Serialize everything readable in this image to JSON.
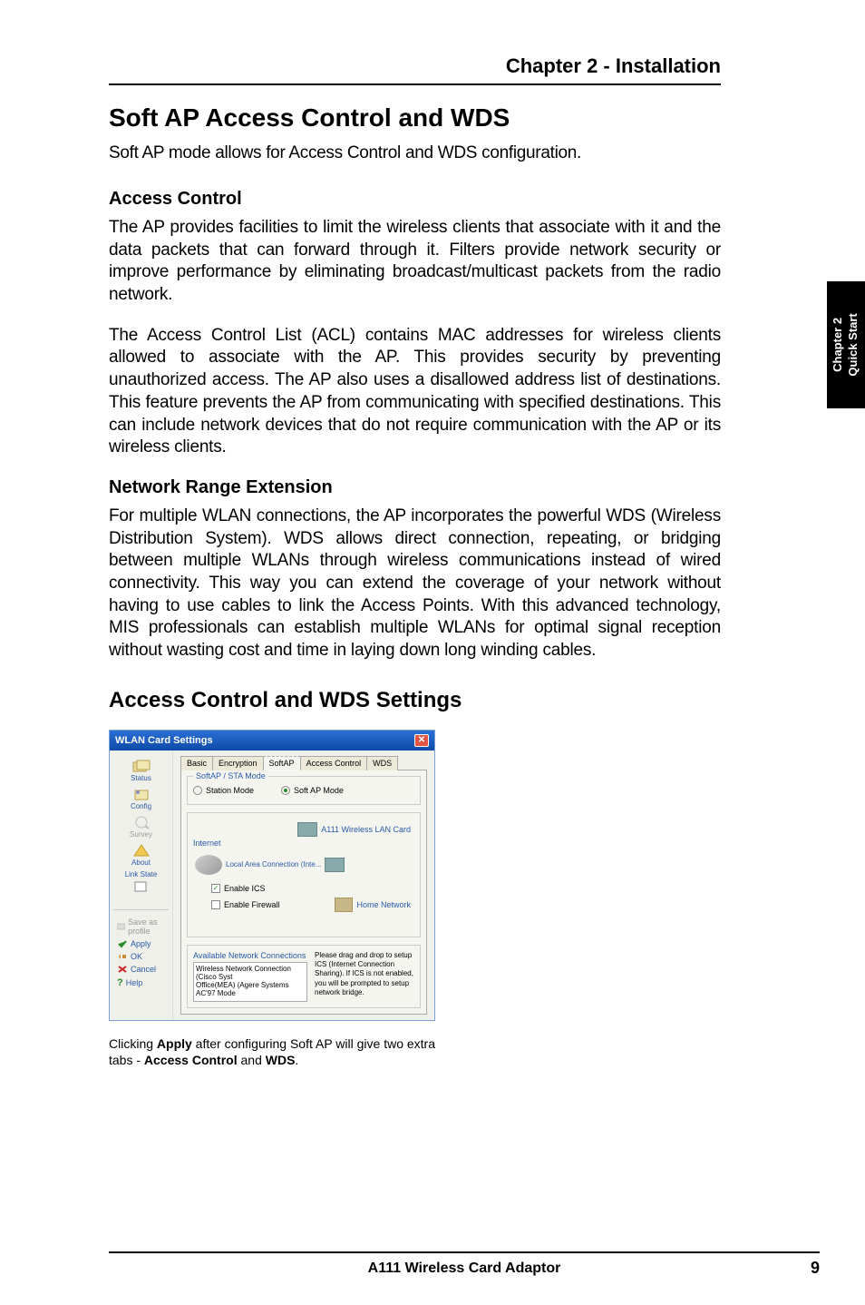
{
  "chapter_header": "Chapter 2 - Installation",
  "h1": "Soft AP Access Control and WDS",
  "intro": "Soft AP mode allows for Access Control and WDS configuration.",
  "sections": {
    "access_control": {
      "heading": "Access Control",
      "p1": "The AP provides facilities to limit the wireless clients that associate with it and the data packets that can forward through it. Filters provide network security or improve performance by eliminating broadcast/multicast packets from the radio network.",
      "p2": "The Access Control List (ACL) contains MAC addresses for wireless clients allowed to associate with the AP. This provides security by preventing unauthorized access. The AP also uses a disallowed address list of destinations. This feature prevents the AP from communicating with specified destinations. This can include network devices that do not require communication with the AP or its wireless clients."
    },
    "network_range": {
      "heading": "Network Range Extension",
      "p1": "For multiple WLAN connections, the AP incorporates the powerful WDS (Wireless Distribution System). WDS allows direct connection, repeating, or bridging between multiple WLANs through wireless communications instead of wired connectivity. This way you can extend the coverage of your network without having to use cables to link the Access Points. With this advanced technology, MIS professionals can establish multiple WLANs for optimal signal reception without wasting cost and time in laying down long winding cables."
    }
  },
  "settings_heading": "Access Control and WDS Settings",
  "screenshot": {
    "title": "WLAN Card Settings",
    "sidebar": {
      "status": "Status",
      "config": "Config",
      "survey": "Survey",
      "about": "About",
      "link_state": "Link State",
      "save_profile": "Save as profile",
      "apply": "Apply",
      "ok": "OK",
      "cancel": "Cancel",
      "help": "Help"
    },
    "tabs": {
      "basic": "Basic",
      "encryption": "Encryption",
      "softap": "SoftAP",
      "access_control": "Access Control",
      "wds": "WDS"
    },
    "mode_group": {
      "legend": "SoftAP / STA Mode",
      "station": "Station Mode",
      "softap": "Soft AP Mode"
    },
    "diagram": {
      "card_label": "A111 Wireless LAN Card",
      "internet": "Internet",
      "local_conn": "Local Area Connection (Inte...",
      "enable_ics": "Enable ICS",
      "enable_firewall": "Enable Firewall",
      "home_network": "Home Network"
    },
    "available": {
      "label": "Available Network Connections",
      "item1": "Wireless Network Connection (Cisco Syst",
      "item2": "Office(MEA) (Agere Systems AC'97 Mode",
      "desc": "Please drag and drop to setup ICS (Internet Connection Sharing). If ICS is not enabled, you will be prompted to setup network bridge."
    }
  },
  "caption_parts": {
    "prefix": "Clicking ",
    "apply": "Apply",
    "mid": " after configuring Soft AP will give two extra tabs - ",
    "ac": "Access Control",
    "and": " and ",
    "wds": "WDS",
    "end": "."
  },
  "footer": {
    "title": "A111 Wireless Card Adaptor",
    "page": "9"
  },
  "side_tab": {
    "line1": "Chapter 2",
    "line2": "Quick Start"
  }
}
